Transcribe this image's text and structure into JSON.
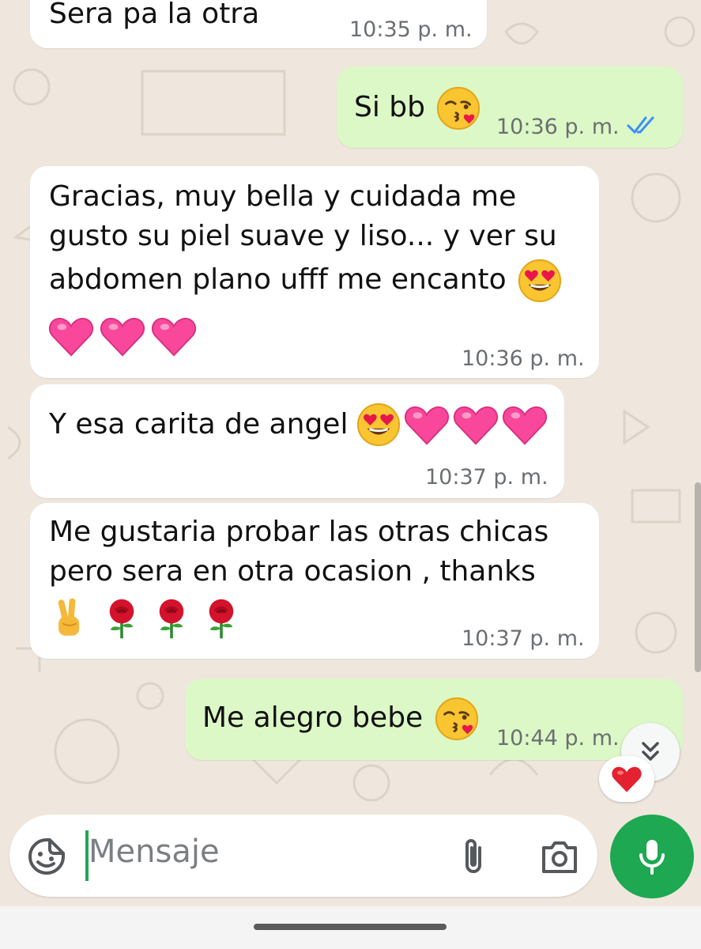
{
  "messages": [
    {
      "id": "m1",
      "direction": "incoming",
      "text": "Sera pa la otra",
      "time": "10:35 p. m."
    },
    {
      "id": "m2",
      "direction": "outgoing",
      "text": "Si bb",
      "emoji": [
        "face-blowing-kiss"
      ],
      "time": "10:36 p. m.",
      "status": "read"
    },
    {
      "id": "m3",
      "direction": "incoming",
      "text_lines": [
        "Gracias, muy bella y cuidada me",
        "gusto su piel suave y liso... y ver su",
        "abdomen plano ufff me encanto"
      ],
      "emoji_inline": [
        "smiling-face-with-heart-eyes"
      ],
      "emoji_line": [
        "pink-heart",
        "pink-heart",
        "pink-heart"
      ],
      "time": "10:36 p. m."
    },
    {
      "id": "m4",
      "direction": "incoming",
      "text": "Y esa carita de angel",
      "emoji": [
        "smiling-face-with-heart-eyes",
        "pink-heart",
        "pink-heart",
        "pink-heart"
      ],
      "time": "10:37 p. m."
    },
    {
      "id": "m5",
      "direction": "incoming",
      "text_lines": [
        "Me gustaria probar las otras chicas",
        "pero sera en otra ocasion , thanks"
      ],
      "emoji_line": [
        "victory-hand",
        "rose",
        "rose",
        "rose"
      ],
      "time": "10:37 p. m."
    },
    {
      "id": "m6",
      "direction": "outgoing",
      "text": "Me alegro bebe",
      "emoji": [
        "face-blowing-kiss"
      ],
      "time": "10:44 p. m.",
      "status": "read",
      "reaction": "red-heart"
    }
  ],
  "composer": {
    "placeholder": "Mensaje",
    "icons": [
      "sticker-icon",
      "paperclip-icon",
      "camera-icon",
      "microphone-icon"
    ]
  },
  "colors": {
    "incoming_bubble": "#ffffff",
    "outgoing_bubble": "#dcf8c6",
    "accent_green": "#1da851",
    "read_ticks": "#3b8ff5",
    "background": "#efe7dd"
  }
}
